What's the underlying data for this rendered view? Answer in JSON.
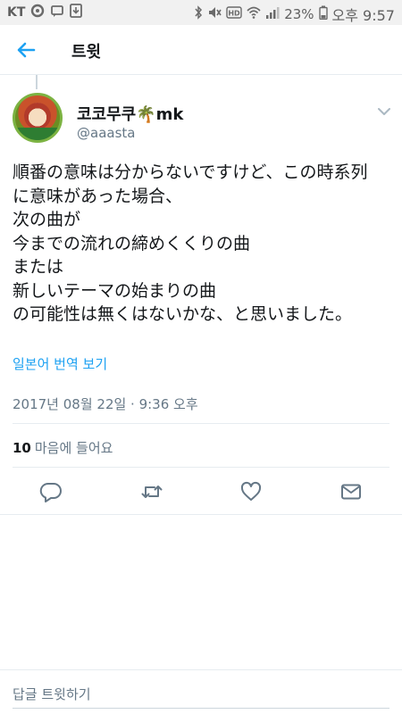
{
  "status_bar": {
    "carrier": "KT",
    "battery_percent": "23%",
    "time": "오후 9:57"
  },
  "header": {
    "title": "트윗"
  },
  "tweet": {
    "display_name": "코코무쿠🌴mk",
    "handle": "@aaasta",
    "lines": [
      "順番の意味は分からないですけど、この時系列",
      "に意味があった場合、",
      "次の曲が",
      "今までの流れの締めくくりの曲",
      "または",
      "新しいテーマの始まりの曲",
      "の可能性は無くはないかな、と思いました。"
    ],
    "translate_label": "일본어 번역 보기",
    "timestamp": "2017년 08월 22일 · 9:36 오후",
    "likes_count": "10",
    "likes_label": "마음에 들어요"
  },
  "reply_bar": {
    "placeholder": "답글 트윗하기"
  },
  "icons": {
    "back": "arrow-left-icon",
    "caret": "chevron-down-icon",
    "reply": "reply-icon",
    "retweet": "retweet-icon",
    "like": "heart-icon",
    "dm": "envelope-icon"
  },
  "colors": {
    "accent": "#1da1f2",
    "muted": "#657786",
    "text": "#14171a"
  }
}
